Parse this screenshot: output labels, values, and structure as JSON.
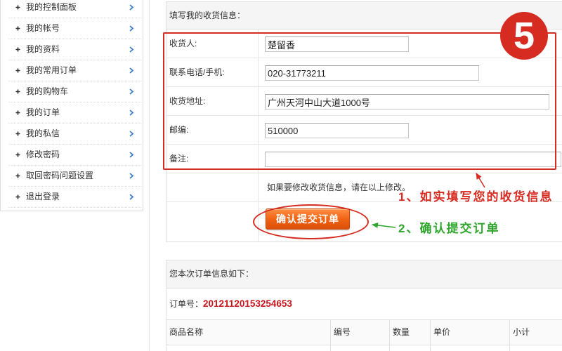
{
  "sidebar": {
    "bullet_icon": "plus-icon",
    "arrow_icon": "chevron-right-icon",
    "items": [
      {
        "label": "我的控制面板"
      },
      {
        "label": "我的帐号"
      },
      {
        "label": "我的资料"
      },
      {
        "label": "我的常用订单"
      },
      {
        "label": "我的购物车"
      },
      {
        "label": "我的订单"
      },
      {
        "label": "我的私信"
      },
      {
        "label": "修改密码"
      },
      {
        "label": "取回密码问题设置"
      },
      {
        "label": "退出登录"
      }
    ]
  },
  "shipping": {
    "title": "填写我的收货信息：",
    "fields": [
      {
        "label": "收货人:",
        "value": "楚留香"
      },
      {
        "label": "联系电话/手机:",
        "value": "020-31773211"
      },
      {
        "label": "收货地址:",
        "value": "广州天河中山大道1000号"
      },
      {
        "label": "邮编:",
        "value": "510000"
      },
      {
        "label": "备注:",
        "value": ""
      }
    ],
    "hint": "如果要修改收货信息，请在以上修改。",
    "submit_label": "确认提交订单"
  },
  "annotations": {
    "step_number": "5",
    "note_1": "1、如实填写您的收货信息",
    "note_2": "2、确认提交订单"
  },
  "order": {
    "title": "您本次订单信息如下：",
    "number_label": "订单号：",
    "number_value": "20121120153254653",
    "columns": [
      "商品名称",
      "编号",
      "数量",
      "单价",
      "小计"
    ]
  },
  "colors": {
    "annotation_red": "#d62b20",
    "annotation_green": "#2ea62b",
    "order_number_red": "#c8161d",
    "button_orange": "#f06414",
    "link_blue": "#3f7fc4",
    "panel_gray": "#f5f5f5"
  }
}
